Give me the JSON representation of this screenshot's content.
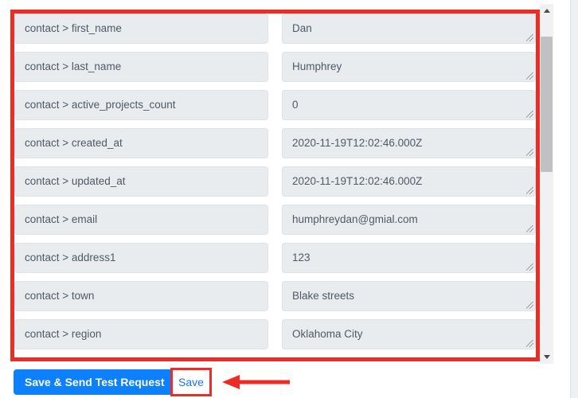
{
  "mapping_panel": {
    "rows": [
      {
        "key": "contact > first_name",
        "value": "Dan"
      },
      {
        "key": "contact > last_name",
        "value": "Humphrey"
      },
      {
        "key": "contact > active_projects_count",
        "value": "0"
      },
      {
        "key": "contact > created_at",
        "value": "2020-11-19T12:02:46.000Z"
      },
      {
        "key": "contact > updated_at",
        "value": "2020-11-19T12:02:46.000Z"
      },
      {
        "key": "contact > email",
        "value": "humphreydan@gmial.com"
      },
      {
        "key": "contact > address1",
        "value": "123"
      },
      {
        "key": "contact > town",
        "value": "Blake streets"
      },
      {
        "key": "contact > region",
        "value": "Oklahoma City"
      },
      {
        "key": "",
        "value": ""
      }
    ]
  },
  "scrollbar": {
    "up_arrow": "scroll-up-arrow-icon",
    "down_arrow": "scroll-down-arrow-icon"
  },
  "footer": {
    "save_send_label": "Save & Send Test Request",
    "save_label": "Save"
  },
  "annotation": {
    "highlight_color": "#ee2b24",
    "arrow": "left-pointing-arrow-icon"
  },
  "colors": {
    "primary_button": "#0d80ff",
    "link": "#1a73ff",
    "field_background": "#e9ecef",
    "highlight": "#ee2b24"
  }
}
